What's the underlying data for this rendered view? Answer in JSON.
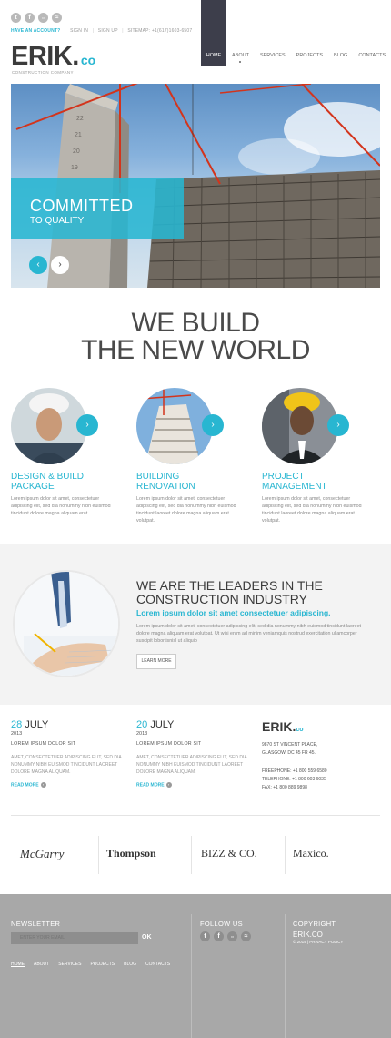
{
  "header": {
    "social": [
      {
        "icon": "twitter-icon",
        "glyph": "t"
      },
      {
        "icon": "facebook-icon",
        "glyph": "f"
      },
      {
        "icon": "flickr-icon",
        "glyph": "••"
      },
      {
        "icon": "rss-icon",
        "glyph": "≈"
      }
    ],
    "top_links": {
      "account": "HAVE AN ACCOUNT?",
      "sign_in": "SIGN IN",
      "sign_up": "SIGN UP",
      "sitemap": "SITEMAP: +1(617)1603-6507"
    },
    "logo_main": "ERIK.",
    "logo_co": "co",
    "logo_sub": "CONSTRUCTION COMPANY",
    "nav": [
      "HOME",
      "ABOUT",
      "SERVICES",
      "PROJECTS",
      "BLOG",
      "CONTACTS"
    ]
  },
  "hero": {
    "title": "COMMITTED",
    "subtitle": "TO QUALITY",
    "prev": "‹",
    "next": "›"
  },
  "big_title": {
    "line1": "WE BUILD",
    "line2": "THE NEW WORLD"
  },
  "features": [
    {
      "title_line1": "DESIGN & BUILD",
      "title_line2": "PACKAGE",
      "text": "Lorem ipsum dolor sit amet, consectetuer adipiscing elit, sed dia nonummy nibh euismod tincidunt dolore magna aliquam erat",
      "arrow": "›"
    },
    {
      "title_line1": "BUILDING",
      "title_line2": "RENOVATION",
      "text": "Lorem ipsum dolor sit amet, consectetuer adipiscing elit, sed dia nonummy nibh euismod tincidunt laoreet dolore magna aliquam erat volutpat.",
      "arrow": "›"
    },
    {
      "title_line1": "PROJECT",
      "title_line2": "MANAGEMENT",
      "text": "Lorem ipsum dolor sit amet, consectetuer adipiscing elit, sed dia nonummy nibh euismod tincidunt laoreet dolore magna aliquam erat volutpat.",
      "arrow": "›"
    }
  ],
  "leaders": {
    "title_line1": "WE ARE THE LEADERS IN THE",
    "title_line2": "CONSTRUCTION INDUSTRY",
    "subtitle": "Lorem ipsum dolor sit amet consectetuer adipiscing.",
    "text": "Lorem ipsum dolor sit amet, consectetuer adipiscing elit, sed dia nonummy nibh euismod tincidunt laoreet dolore magna aliquam erat volutpat. Ut wisi enim ad minim veniamquis nostrud exercitation ullamcorper suscipit lobortisnisl ut aliquip",
    "button": "LEARN MORE"
  },
  "news": [
    {
      "day": "28",
      "month": "JULY",
      "year": "2013",
      "headline": "LOREM IPSUM DOLOR SIT",
      "text": "AMET, CONSECTETUER ADIPISCING ELIT, SED DIA NONUMMY NIBH EUISMOD TINCIDUNT LAOREET DOLORE MAGNA ALIQUAM.",
      "read_more": "READ MORE",
      "arrow": "›"
    },
    {
      "day": "20",
      "month": "JULY",
      "year": "2013",
      "headline": "LOREM IPSUM DOLOR SIT",
      "text": "AMET, CONSECTETUER ADIPISCING ELIT, SED DIA NONUMMY NIBH EUISMOD TINCIDUNT LAOREET DOLORE MAGNA ALIQUAM.",
      "read_more": "READ MORE",
      "arrow": "›"
    }
  ],
  "contact": {
    "logo_main": "ERIK.",
    "logo_co": "co",
    "address1": "9870 ST VINCENT PLACE,",
    "address2": "GLASGOW, DC 45 FR 45.",
    "freephone": "FREEPHONE:  +1 800 559 6580",
    "telephone": "TELEPHONE:  +1 800 603 6035",
    "fax": "FAX:             +1 800 889 9898"
  },
  "partners": [
    "McGarry",
    "Thompson",
    "BIZZ & CO.",
    "Maxico."
  ],
  "footer": {
    "newsletter_title": "NEWSLETTER",
    "email_placeholder": "ENTER YOUR EMAIL",
    "ok": "OK",
    "links": [
      "HOME",
      "ABOUT",
      "SERVICES",
      "PROJECTS",
      "BLOG",
      "CONTACTS"
    ],
    "follow_title": "FOLLOW US",
    "copyright_title": "COPYRIGHT",
    "copyright_logo": "ERIK.CO",
    "copyright_text": "© 2014 | PRIVACY POLICY"
  },
  "colors": {
    "accent": "#28b6d1",
    "dark": "#3d3e4b",
    "footer": "#a8a8a8"
  }
}
